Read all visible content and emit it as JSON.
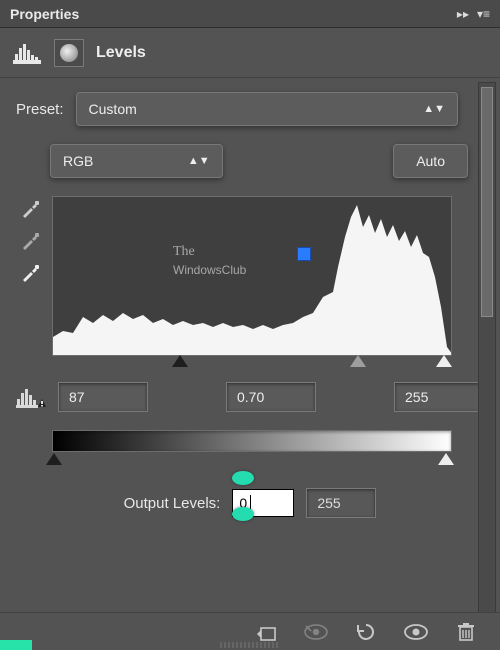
{
  "header": {
    "title": "Properties"
  },
  "subheader": {
    "title": "Levels"
  },
  "preset": {
    "label": "Preset:",
    "value": "Custom"
  },
  "channel": {
    "value": "RGB",
    "auto_label": "Auto"
  },
  "input_levels": {
    "shadow": "87",
    "mid": "0.70",
    "highlight": "255"
  },
  "output_levels": {
    "label": "Output Levels:",
    "low": "0",
    "high": "255"
  },
  "watermark": {
    "line1": "The",
    "line2": "WindowsClub"
  },
  "colors": {
    "cursor": "#24dcb0"
  }
}
